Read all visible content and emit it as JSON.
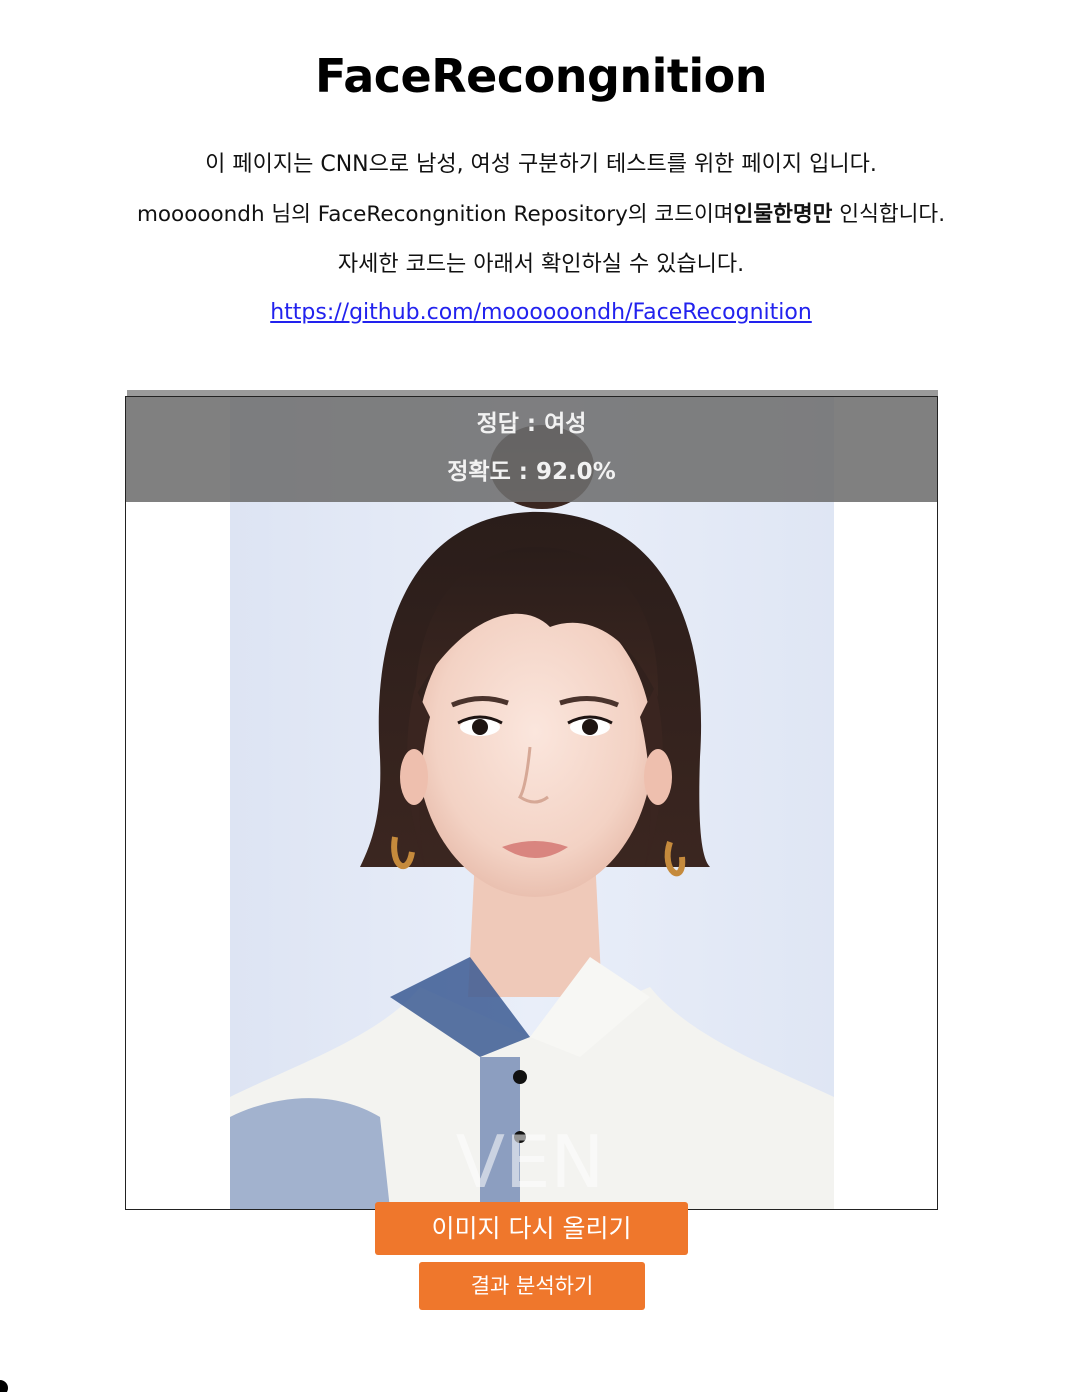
{
  "page": {
    "title": "FaceRecongnition",
    "description_line1": "이 페이지는 CNN으로 남성, 여성 구분하기 테스트를 위한 페이지 입니다.",
    "description_line2_pre": "mooooondh 님의 FaceRecongnition Repository의 코드이며",
    "description_line2_bold": "인물한명만",
    "description_line2_post": " 인식합니다.",
    "description_line3": "자세한 코드는 아래서 확인하실 수 있습니다.",
    "repo_link_text": "https://github.com/moooooondh/FaceRecognition",
    "repo_link_href": "https://github.com/moooooondh/FaceRecognition"
  },
  "result": {
    "answer": "정답 : 여성",
    "accuracy": "정확도 : 92.0%"
  },
  "image": {
    "alt": "uploaded portrait photo",
    "watermark": "VEN"
  },
  "buttons": {
    "reupload_label": "이미지 다시 올리기",
    "analyze_label": "결과 분석하기"
  },
  "colors": {
    "button_bg": "#ef772c",
    "button_text": "#ffffff",
    "overlay_bg": "#6e6e6e",
    "link": "#2222ee",
    "photo_bg": "#e3e9f6"
  }
}
